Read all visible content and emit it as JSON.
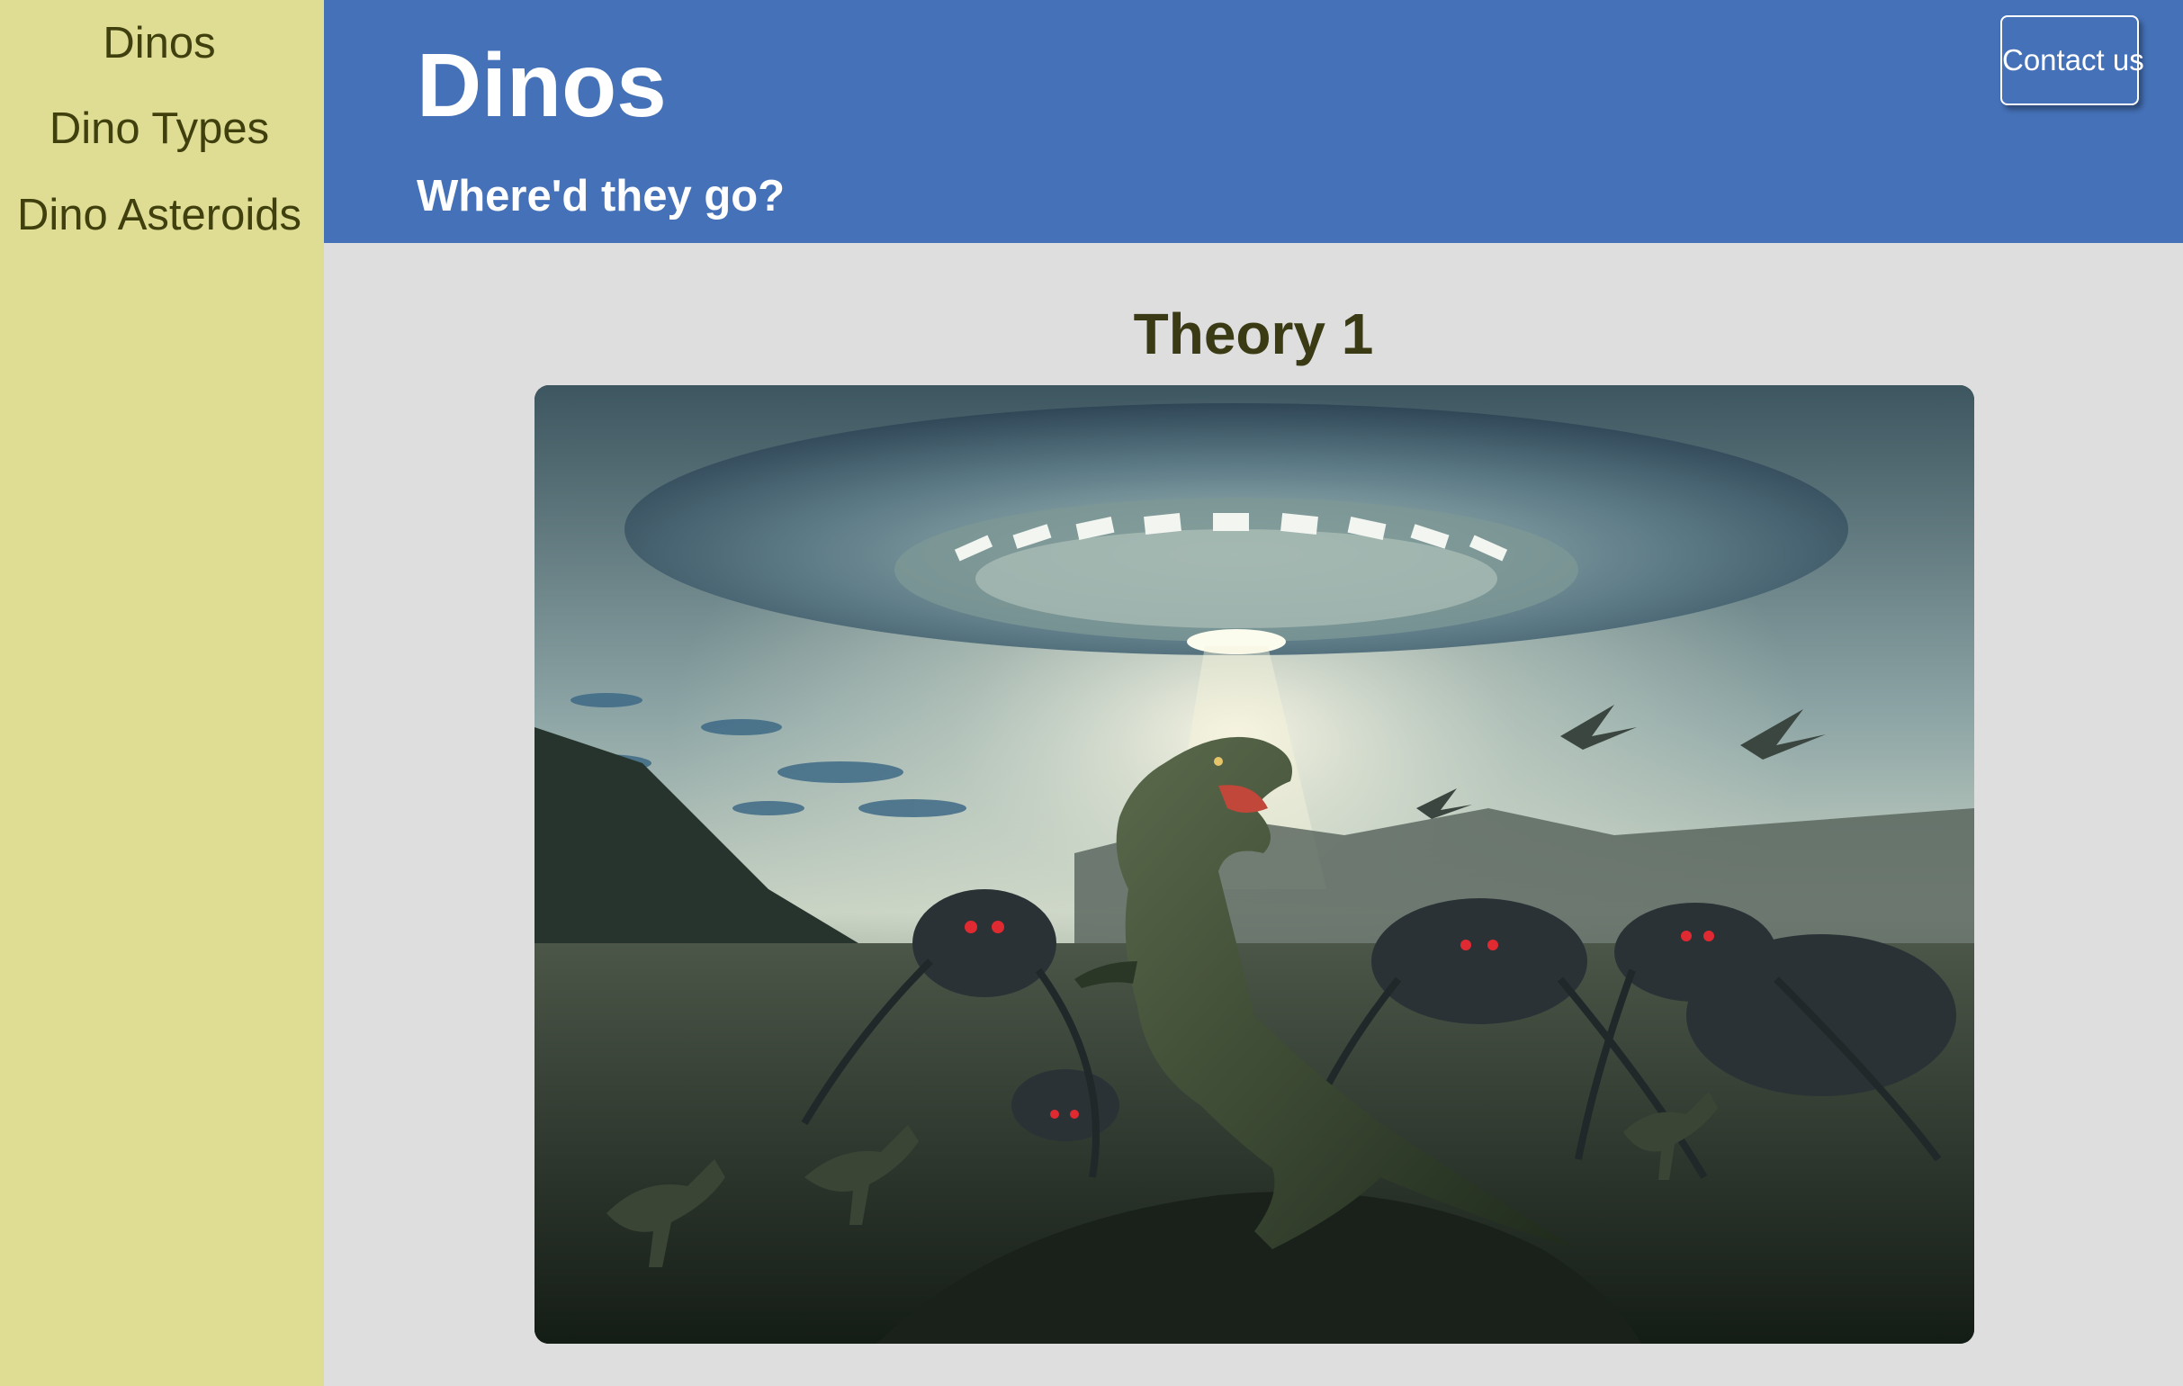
{
  "sidebar": {
    "items": [
      {
        "label": "Dinos"
      },
      {
        "label": "Dino Types"
      },
      {
        "label": "Dino Asteroids"
      }
    ]
  },
  "header": {
    "title": "Dinos",
    "subtitle": "Where'd they go?",
    "contact_label": "Contact us"
  },
  "main": {
    "heading": "Theory 1",
    "image_icon": "ufo-dinosaur-illustration"
  },
  "colors": {
    "sidebar_bg": "#dfdc93",
    "header_bg": "#4571b8",
    "page_bg": "#dedede",
    "text_dark": "#40400f"
  }
}
